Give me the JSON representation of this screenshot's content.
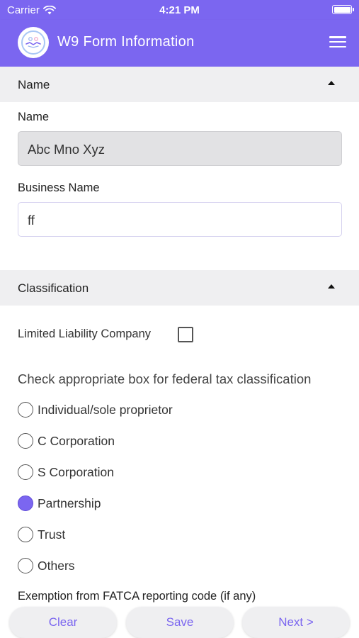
{
  "status_bar": {
    "carrier": "Carrier",
    "time": "4:21 PM"
  },
  "app_bar": {
    "title": "W9 Form Information"
  },
  "sections": {
    "name": {
      "header": "Name",
      "name_label": "Name",
      "name_value": "Abc Mno Xyz",
      "business_label": "Business Name",
      "business_value": "ff"
    },
    "classification": {
      "header": "Classification",
      "llc_label": "Limited Liability Company",
      "llc_checked": false,
      "instruction": "Check appropriate box for federal tax classification",
      "options": [
        {
          "label": "Individual/sole proprietor",
          "selected": false
        },
        {
          "label": "C Corporation",
          "selected": false
        },
        {
          "label": "S Corporation",
          "selected": false
        },
        {
          "label": "Partnership",
          "selected": true
        },
        {
          "label": "Trust",
          "selected": false
        },
        {
          "label": "Others",
          "selected": false
        }
      ],
      "fatca_label": "Exemption from FATCA reporting code (if any)"
    }
  },
  "actions": {
    "clear": "Clear",
    "save": "Save",
    "next": "Next >"
  },
  "colors": {
    "accent": "#7b66f0",
    "section_bg": "#efeff1"
  }
}
